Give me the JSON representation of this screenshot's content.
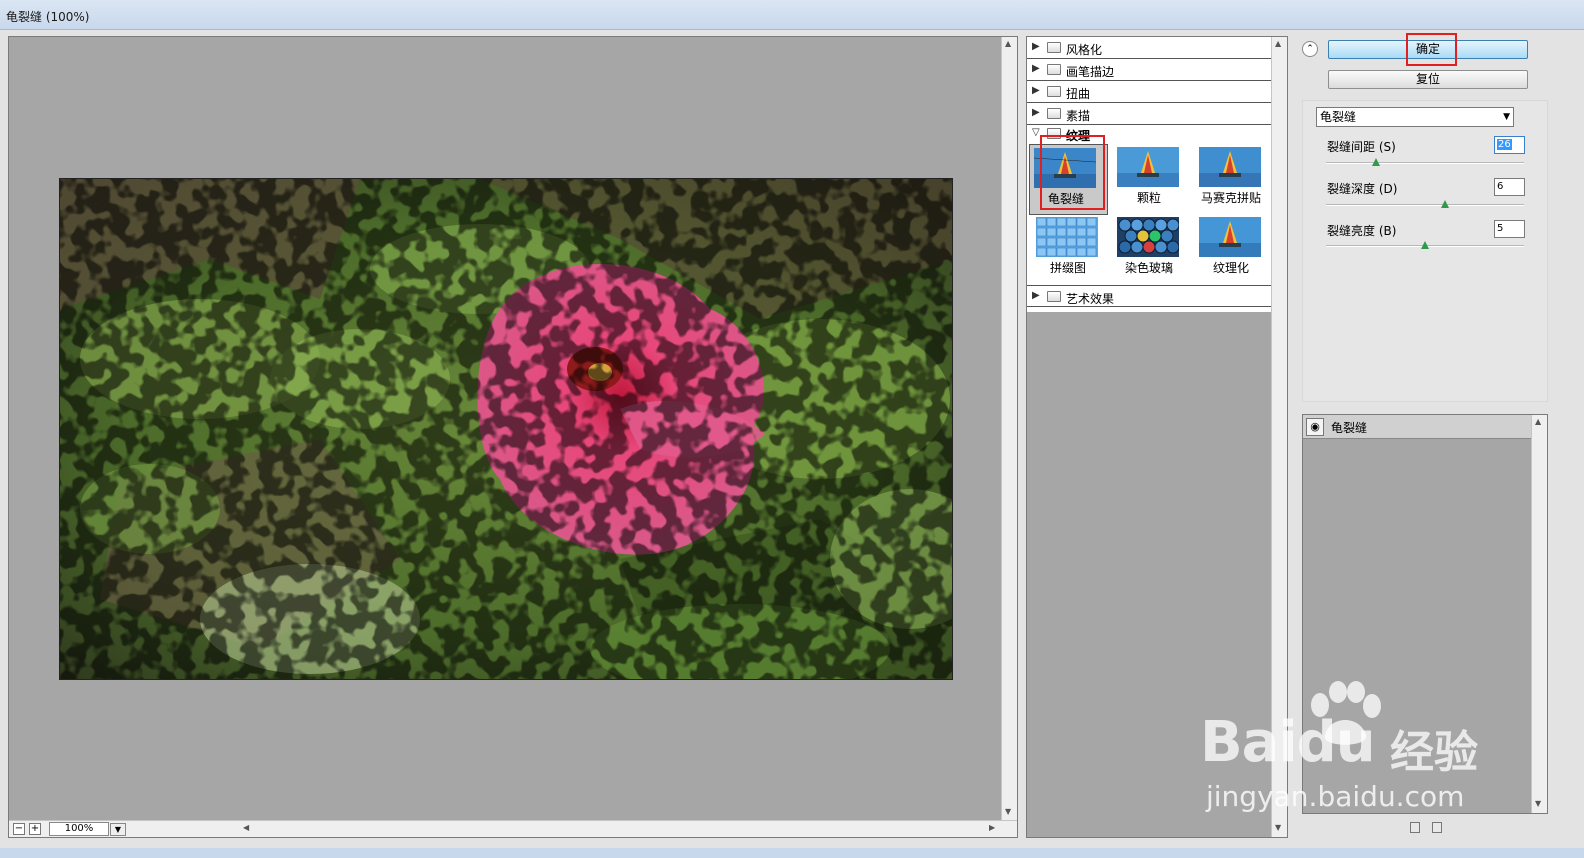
{
  "window": {
    "title": "龟裂缝 (100%)"
  },
  "preview": {
    "zoom_minus": "−",
    "zoom_plus": "+",
    "zoom_value": "100%"
  },
  "gallery": {
    "categories": [
      {
        "label": "风格化",
        "expanded": false
      },
      {
        "label": "画笔描边",
        "expanded": false
      },
      {
        "label": "扭曲",
        "expanded": false
      },
      {
        "label": "素描",
        "expanded": false
      },
      {
        "label": "纹理",
        "expanded": true
      },
      {
        "label": "艺术效果",
        "expanded": false
      }
    ],
    "thumbnails": [
      {
        "label": "龟裂缝",
        "selected": true
      },
      {
        "label": "颗粒",
        "selected": false
      },
      {
        "label": "马赛克拼贴",
        "selected": false
      },
      {
        "label": "拼缀图",
        "selected": false
      },
      {
        "label": "染色玻璃",
        "selected": false
      },
      {
        "label": "纹理化",
        "selected": false
      }
    ]
  },
  "buttons": {
    "ok": "确定",
    "reset": "复位"
  },
  "settings": {
    "selected_filter": "龟裂缝",
    "params": [
      {
        "label": "裂缝间距 (S)",
        "value": "26",
        "fraction": 0.25
      },
      {
        "label": "裂缝深度 (D)",
        "value": "6",
        "fraction": 0.6
      },
      {
        "label": "裂缝亮度 (B)",
        "value": "5",
        "fraction": 0.5
      }
    ]
  },
  "layers": {
    "items": [
      {
        "label": "龟裂缝",
        "visible": true
      }
    ]
  },
  "watermark": {
    "brand": "Bai",
    "brand2": "du",
    "cn": "经验",
    "url": "jingyan.baidu.com"
  },
  "colors": {
    "accent_red": "#e02020",
    "ok_button": "#a9dbf6",
    "canvas_gray": "#a6a6a6"
  }
}
